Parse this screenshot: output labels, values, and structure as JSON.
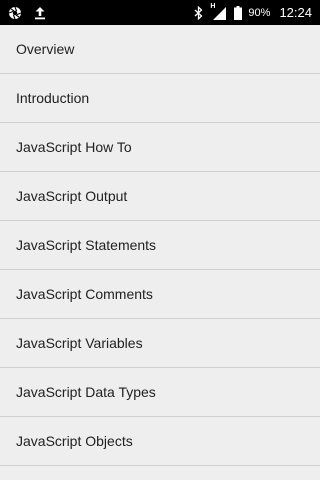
{
  "status_bar": {
    "left_icons": [
      "aperture-icon",
      "upload-arrow-icon"
    ],
    "right_icons": [
      "bluetooth-icon",
      "signal-icon",
      "battery-icon"
    ],
    "network_type": "H",
    "battery": "90%",
    "time": "12:24"
  },
  "menu": {
    "items": [
      {
        "label": "Overview"
      },
      {
        "label": "Introduction"
      },
      {
        "label": "JavaScript How To"
      },
      {
        "label": "JavaScript Output"
      },
      {
        "label": "JavaScript Statements"
      },
      {
        "label": "JavaScript Comments"
      },
      {
        "label": "JavaScript Variables"
      },
      {
        "label": "JavaScript Data Types"
      },
      {
        "label": "JavaScript Objects"
      }
    ]
  }
}
